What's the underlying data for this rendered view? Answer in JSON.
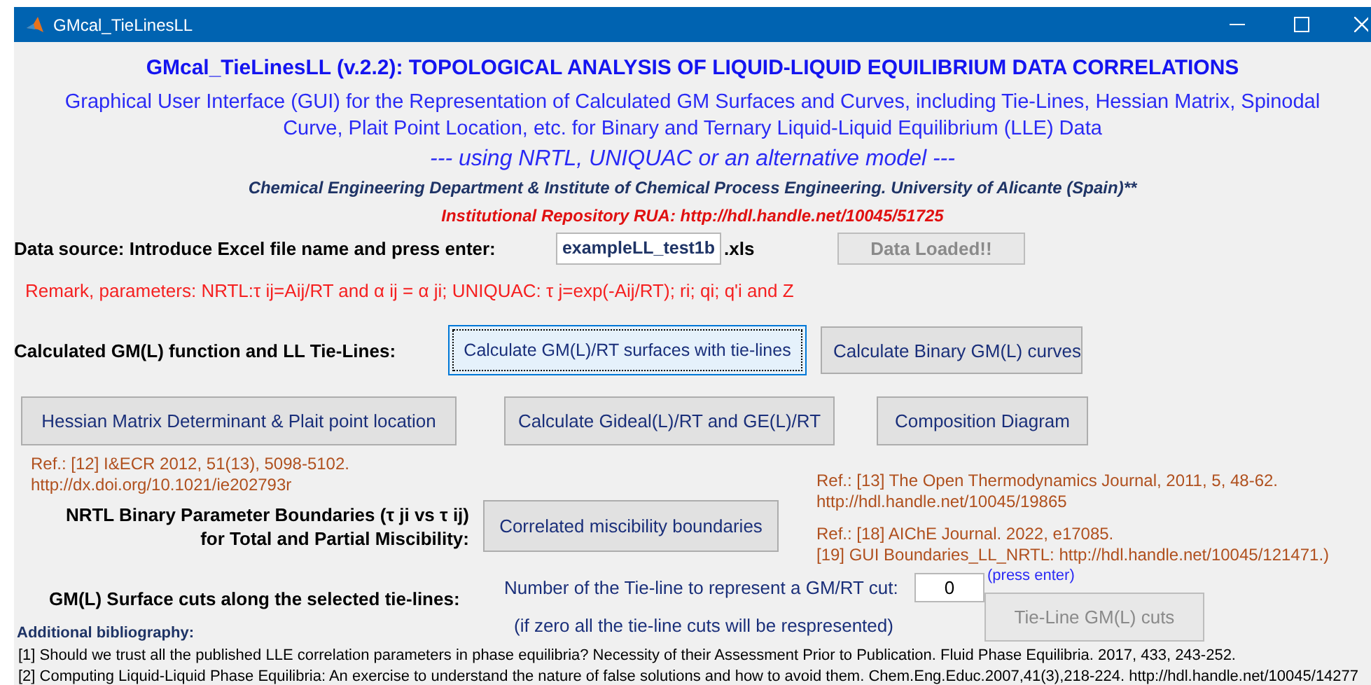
{
  "window": {
    "title": "GMcal_TieLinesLL"
  },
  "header": {
    "title": "GMcal_TieLinesLL (v.2.2): TOPOLOGICAL ANALYSIS OF LIQUID-LIQUID EQUILIBRIUM DATA CORRELATIONS",
    "subtitle": "Graphical User Interface (GUI) for the Representation of Calculated GM Surfaces and Curves, including Tie-Lines, Hessian Matrix, Spinodal\nCurve, Plait Point Location, etc. for Binary and Ternary Liquid-Liquid Equilibrium (LLE) Data",
    "models_line": "--- using  NRTL, UNIQUAC or an alternative model ---",
    "affiliation": "Chemical Engineering Department & Institute of Chemical Process Engineering. University of Alicante (Spain)**",
    "repository": "Institutional Repository RUA: http://hdl.handle.net/10045/51725"
  },
  "data_source": {
    "label": "Data source: Introduce Excel file name and press enter:",
    "file": {
      "value": "exampleLL_test1b"
    },
    "extension": ".xls",
    "load_button": {
      "label": "Data Loaded!!",
      "disabled": true,
      "focused": false
    }
  },
  "remark": "Remark, parameters: NRTL:τ ij=Aij/RT and α ij = α ji; UNIQUAC: τ  j=exp(-Aij/RT); ri; qi; q'i and Z",
  "tie_lines": {
    "label": "Calculated GM(L) function and LL Tie-Lines:",
    "buttons": [
      {
        "label": "Calculate GM(L)/RT surfaces with tie-lines",
        "disabled": false,
        "focused": true
      },
      {
        "label": "Calculate Binary GM(L) curves",
        "disabled": false,
        "focused": false
      }
    ]
  },
  "analysis_buttons": [
    {
      "label": "Hessian Matrix Determinant & Plait point location",
      "disabled": false,
      "focused": false
    },
    {
      "label": "Calculate Gideal(L)/RT and GE(L)/RT",
      "disabled": false,
      "focused": false
    },
    {
      "label": "Composition Diagram",
      "disabled": false,
      "focused": false
    }
  ],
  "references_left": [
    [
      "Ref.: [12] I&ECR 2012, 51(13), 5098-5102.",
      "http://dx.doi.org/10.1021/ie202793r"
    ]
  ],
  "boundaries": {
    "label": "NRTL Binary Parameter Boundaries (τ ji vs τ ij)\nfor Total and Partial Miscibility:",
    "button": {
      "label": "Correlated miscibility boundaries",
      "disabled": false,
      "focused": false
    }
  },
  "references_right": [
    [
      "Ref.: [13] The Open Thermodynamics Journal, 2011, 5, 48-62.",
      "http://hdl.handle.net/10045/19865"
    ],
    [
      "Ref.: [18] AIChE Journal. 2022, e17085.",
      "[19] GUI Boundaries_LL_NRTL: http://hdl.handle.net/10045/121471.)"
    ]
  ],
  "surface_cuts": {
    "label": "GM(L) Surface cuts along the selected tie-lines:",
    "prompt": "Number of the Tie-line to represent a GM/RT cut:",
    "cut_field": {
      "value": "0"
    },
    "hint": "(press enter)",
    "note": "(if zero all the tie-line cuts will be respresented)",
    "button": {
      "label": "Tie-Line GM(L) cuts",
      "disabled": true,
      "focused": false
    }
  },
  "bibliography": {
    "heading": "Additional bibliography:",
    "items": [
      "[1] Should we trust all the published LLE correlation parameters in phase equilibria? Necessity of their Assessment Prior to Publication. Fluid Phase Equilibria. 2017, 433, 243-252.",
      "[2] Computing Liquid-Liquid Phase Equilibria: An exercise to understand the nature of false solutions and how to avoid them. Chem.Eng.Educ.2007,41(3),218-224. http://hdl.handle.net/10045/14277"
    ]
  }
}
